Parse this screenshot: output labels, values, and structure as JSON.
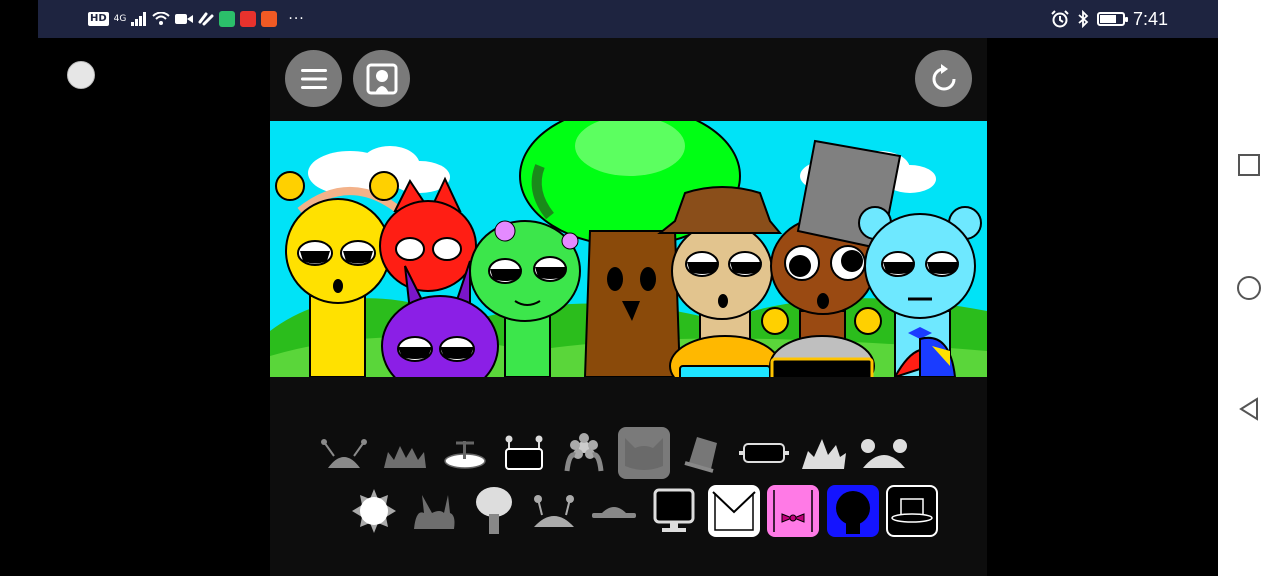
{
  "status_bar": {
    "network_badge": "HD",
    "network_type": "4G",
    "time": "7:41",
    "more": "···",
    "battery_level": 0.75,
    "app_colors": [
      "#2bbf6a",
      "#e8322d",
      "#f05a24"
    ]
  },
  "toolbar": {
    "menu_icon": "hamburger-icon",
    "gallery_icon": "portrait-frame-icon",
    "reset_icon": "refresh-icon"
  },
  "scene": {
    "sky_color": "#00e3f7",
    "grass_color": "#2bbd1c",
    "characters": [
      {
        "name": "yellow",
        "color": "#ffe100"
      },
      {
        "name": "red",
        "color": "#ff1e14"
      },
      {
        "name": "purple",
        "color": "#8b1fe6"
      },
      {
        "name": "green",
        "color": "#3ce64b"
      },
      {
        "name": "tree",
        "color": "#8a4a0a"
      },
      {
        "name": "tan",
        "color": "#e2c48e"
      },
      {
        "name": "brown",
        "color": "#9a4a12"
      },
      {
        "name": "cyan",
        "color": "#6ee8ff"
      }
    ]
  },
  "tray": {
    "row1": [
      {
        "icon": "antenna-head-icon",
        "selected": false,
        "bg": "none"
      },
      {
        "icon": "spiky-head-icon",
        "selected": false,
        "bg": "none"
      },
      {
        "icon": "propeller-cap-icon",
        "selected": true,
        "bg": "#bfbfbf"
      },
      {
        "icon": "robot-screen-icon",
        "selected": false,
        "bg": "none"
      },
      {
        "icon": "flower-head-icon",
        "selected": false,
        "bg": "none"
      },
      {
        "icon": "cat-ears-icon",
        "selected": true,
        "bg": "#7a7a7a"
      },
      {
        "icon": "bucket-hat-icon",
        "selected": false,
        "bg": "none"
      },
      {
        "icon": "visor-icon",
        "selected": false,
        "bg": "none"
      },
      {
        "icon": "crown-spikes-icon",
        "selected": false,
        "bg": "none"
      },
      {
        "icon": "bear-ears-icon",
        "selected": false,
        "bg": "none"
      }
    ],
    "row2": [
      {
        "icon": "sun-head-icon",
        "selected": false,
        "bg": "none"
      },
      {
        "icon": "horns-icon",
        "selected": false,
        "bg": "none"
      },
      {
        "icon": "tree-top-icon",
        "selected": false,
        "bg": "none"
      },
      {
        "icon": "lollipop-antennas-icon",
        "selected": false,
        "bg": "none"
      },
      {
        "icon": "brim-hat-icon",
        "selected": false,
        "bg": "none"
      },
      {
        "icon": "tv-head-icon",
        "selected": false,
        "bg": "none"
      },
      {
        "icon": "white-envelope-icon",
        "selected": true,
        "bg": "#ffffff"
      },
      {
        "icon": "pink-bow-icon",
        "selected": true,
        "bg": "#ff7ae6"
      },
      {
        "icon": "blue-silhouette-icon",
        "selected": true,
        "bg": "#1414ff"
      },
      {
        "icon": "black-top-hat-icon",
        "selected": true,
        "bg": "#000000"
      }
    ]
  }
}
